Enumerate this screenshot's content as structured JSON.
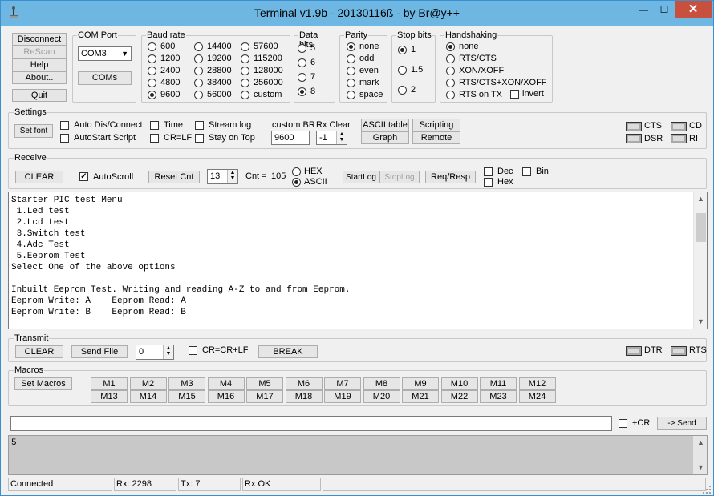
{
  "window": {
    "title": "Terminal v1.9b - 20130116ß - by Br@y++",
    "min_glyph": "—",
    "max_glyph": "☐",
    "close_glyph": "✕"
  },
  "side_buttons": {
    "disconnect": "Disconnect",
    "rescan": "ReScan",
    "help": "Help",
    "about": "About..",
    "quit": "Quit"
  },
  "com_port": {
    "caption": "COM Port",
    "selected": "COM3",
    "coms_button": "COMs"
  },
  "baud": {
    "caption": "Baud rate",
    "options": [
      "600",
      "1200",
      "2400",
      "4800",
      "9600",
      "14400",
      "19200",
      "28800",
      "38400",
      "56000",
      "57600",
      "115200",
      "128000",
      "256000",
      "custom"
    ],
    "selected": "9600"
  },
  "data_bits": {
    "caption": "Data bits",
    "options": [
      "5",
      "6",
      "7",
      "8"
    ],
    "selected": "8"
  },
  "parity": {
    "caption": "Parity",
    "options": [
      "none",
      "odd",
      "even",
      "mark",
      "space"
    ],
    "selected": "none"
  },
  "stop_bits": {
    "caption": "Stop bits",
    "options": [
      "1",
      "1.5",
      "2"
    ],
    "selected": "1"
  },
  "handshaking": {
    "caption": "Handshaking",
    "options": [
      "none",
      "RTS/CTS",
      "XON/XOFF",
      "RTS/CTS+XON/XOFF",
      "RTS on TX"
    ],
    "selected": "none",
    "invert_label": "invert"
  },
  "settings": {
    "caption": "Settings",
    "set_font": "Set font",
    "auto_dis_connect": "Auto Dis/Connect",
    "autostart_script": "AutoStart Script",
    "time": "Time",
    "cr_lf": "CR=LF",
    "stream_log": "Stream log",
    "stay_on_top": "Stay on Top",
    "custom_br_label": "custom BR",
    "custom_br_value": "9600",
    "rx_clear_label": "Rx Clear",
    "rx_clear_value": "-1",
    "ascii_table": "ASCII table",
    "scripting": "Scripting",
    "graph": "Graph",
    "remote": "Remote",
    "leds": {
      "cts": "CTS",
      "cd": "CD",
      "dsr": "DSR",
      "ri": "RI"
    }
  },
  "receive": {
    "caption": "Receive",
    "clear": "CLEAR",
    "autoscroll": "AutoScroll",
    "reset_cnt": "Reset Cnt",
    "cnt_spin_value": "13",
    "cnt_label": "Cnt =",
    "cnt_value": "105",
    "hex": "HEX",
    "ascii": "ASCII",
    "startlog": "StartLog",
    "stoplog": "StopLog",
    "req_resp": "Req/Resp",
    "dec": "Dec",
    "hex_chk": "Hex",
    "bin": "Bin",
    "text": "Starter PIC test Menu\n 1.Led test\n 2.Lcd test\n 3.Switch test\n 4.Adc Test\n 5.Eeprom Test\nSelect One of the above options\n\nInbuilt Eeprom Test. Writing and reading A-Z to and from Eeprom.\nEeprom Write: A    Eeprom Read: A\nEeprom Write: B    Eeprom Read: B"
  },
  "transmit": {
    "caption": "Transmit",
    "clear": "CLEAR",
    "send_file": "Send File",
    "spin_value": "0",
    "cr_crlf": "CR=CR+LF",
    "break": "BREAK",
    "leds": {
      "dtr": "DTR",
      "rts": "RTS"
    }
  },
  "macros": {
    "caption": "Macros",
    "set_macros": "Set Macros",
    "row1": [
      "M1",
      "M2",
      "M3",
      "M4",
      "M5",
      "M6",
      "M7",
      "M8",
      "M9",
      "M10",
      "M11",
      "M12"
    ],
    "row2": [
      "M13",
      "M14",
      "M15",
      "M16",
      "M17",
      "M18",
      "M19",
      "M20",
      "M21",
      "M22",
      "M23",
      "M24"
    ]
  },
  "send_line": {
    "input_value": "",
    "plus_cr": "+CR",
    "send": "-> Send"
  },
  "transmit_log": {
    "text": "5"
  },
  "status": {
    "connection": "Connected",
    "rx": "Rx: 2298",
    "tx": "Tx: 7",
    "rx_state": "Rx OK"
  }
}
